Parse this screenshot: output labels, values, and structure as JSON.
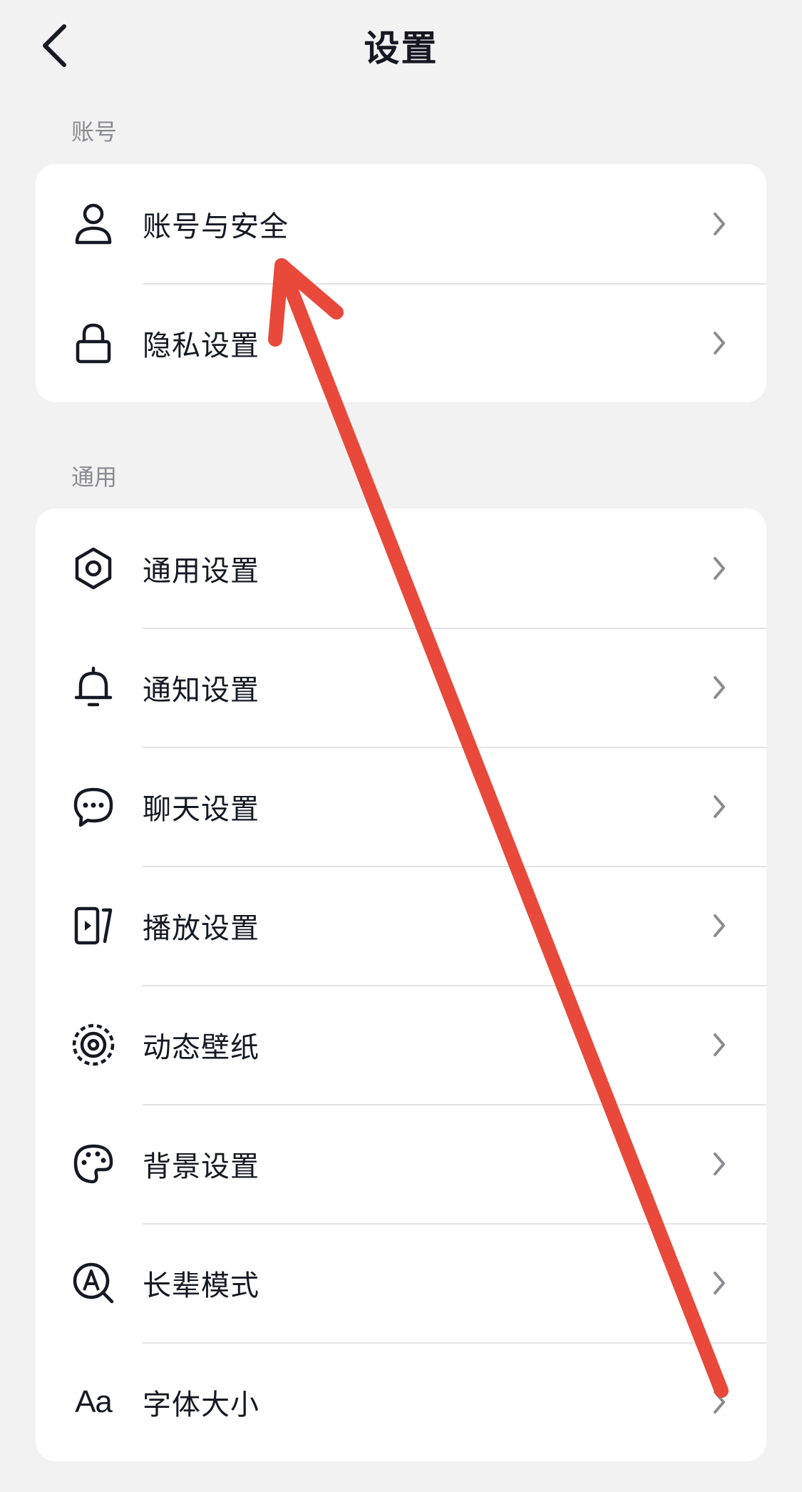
{
  "header": {
    "title": "设置"
  },
  "sections": [
    {
      "label": "账号",
      "items": [
        {
          "label": "账号与安全",
          "icon": "user-icon"
        },
        {
          "label": "隐私设置",
          "icon": "lock-icon"
        }
      ]
    },
    {
      "label": "通用",
      "items": [
        {
          "label": "通用设置",
          "icon": "gear-icon"
        },
        {
          "label": "通知设置",
          "icon": "bell-icon"
        },
        {
          "label": "聊天设置",
          "icon": "chat-bubble-icon"
        },
        {
          "label": "播放设置",
          "icon": "play-screen-icon"
        },
        {
          "label": "动态壁纸",
          "icon": "live-wallpaper-icon"
        },
        {
          "label": "背景设置",
          "icon": "palette-icon"
        },
        {
          "label": "长辈模式",
          "icon": "elder-mode-icon"
        },
        {
          "label": "字体大小",
          "icon": "font-size-icon",
          "icon_text": "Aa"
        }
      ]
    }
  ],
  "annotation": {
    "type": "arrow",
    "color": "#e8493a"
  },
  "colors": {
    "background": "#f2f2f2",
    "card": "#ffffff",
    "text": "#161823",
    "secondary": "#8a8b91",
    "chevron": "#8a8b91"
  }
}
